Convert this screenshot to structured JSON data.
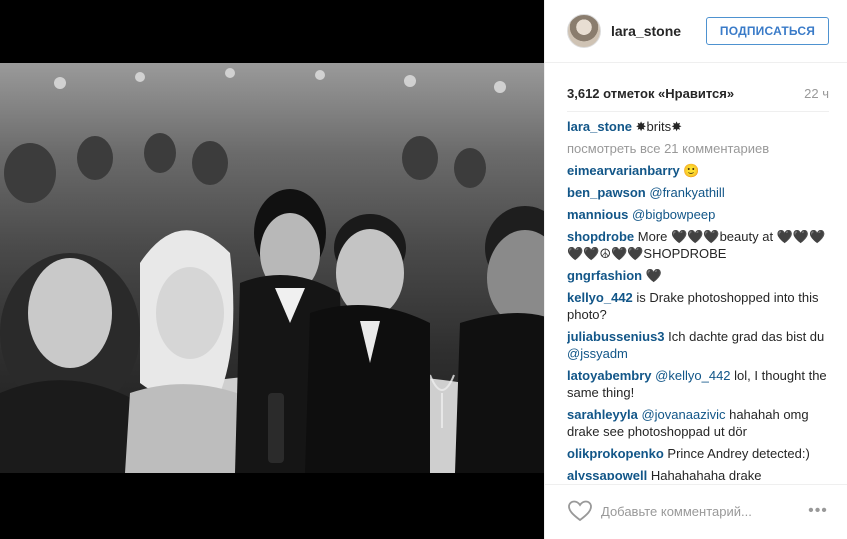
{
  "header": {
    "username": "lara_stone",
    "follow_label": "ПОДПИСАТЬСЯ"
  },
  "post": {
    "likes": "3,612 отметок «Нравится»",
    "time": "22 ч",
    "view_all": "посмотреть все 21 комментариев"
  },
  "comments": [
    {
      "user": "lara_stone",
      "text": " ✸brits✸",
      "mention": "",
      "after": ""
    },
    {
      "user": "eimearvarianbarry",
      "text": " 🙂",
      "mention": "",
      "after": ""
    },
    {
      "user": "ben_pawson",
      "text": " ",
      "mention": "@frankyathill",
      "after": ""
    },
    {
      "user": "mannious",
      "text": " ",
      "mention": "@bigbowpeep",
      "after": ""
    },
    {
      "user": "shopdrobe",
      "text": " More 🖤🖤🖤beauty at 🖤🖤🖤 🖤🖤☮🖤🖤SHOPDROBE",
      "mention": "",
      "after": ""
    },
    {
      "user": "gngrfashion",
      "text": " 🖤",
      "mention": "",
      "after": ""
    },
    {
      "user": "kellyo_442",
      "text": " is Drake photoshopped into this photo?",
      "mention": "",
      "after": ""
    },
    {
      "user": "juliabussenius3",
      "text": " Ich dachte grad das bist du ",
      "mention": "@jssyadm",
      "after": ""
    },
    {
      "user": "latoyabembry",
      "text": " ",
      "mention": "@kellyo_442",
      "after": " lol, I thought the same thing!"
    },
    {
      "user": "sarahleyyla",
      "text": " ",
      "mention": "@jovanaazivic",
      "after": " hahahah omg drake see photoshoppad ut dör"
    },
    {
      "user": "olikprokopenko",
      "text": " Prince Andrey detected:)",
      "mention": "",
      "after": ""
    },
    {
      "user": "alyssapowell",
      "text": " Hahahahaha drake",
      "mention": "",
      "after": ""
    }
  ],
  "footer": {
    "comment_placeholder": "Добавьте комментарий...",
    "more_label": "•••"
  },
  "icons": {
    "like": "heart-icon",
    "more": "more-options-icon"
  },
  "colors": {
    "accent": "#125688",
    "follow_border": "#4e92d0",
    "muted": "#999999"
  }
}
